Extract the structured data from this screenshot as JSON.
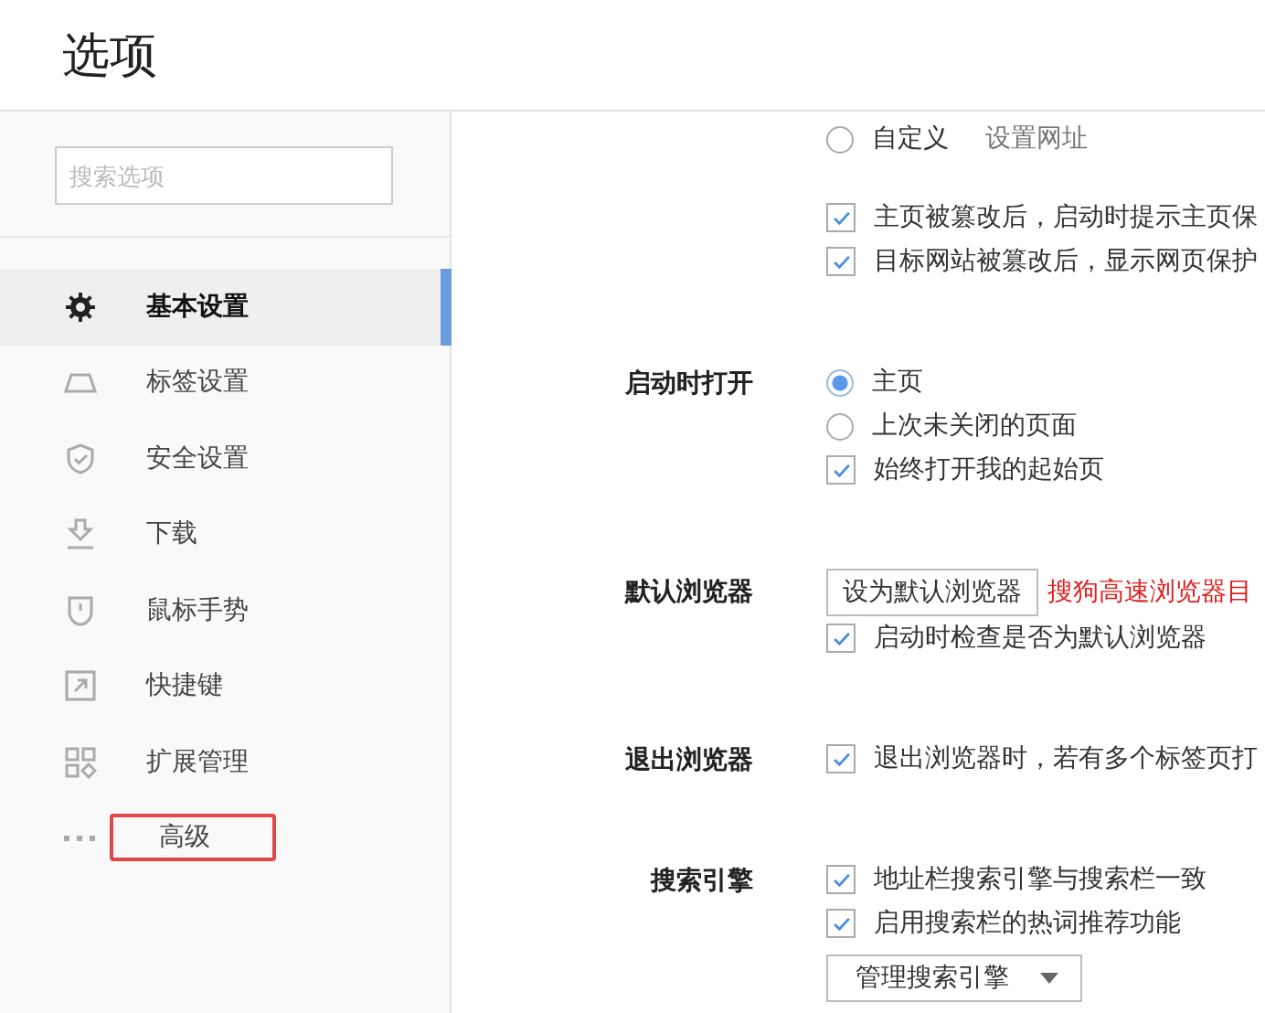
{
  "window": {
    "title": "选项"
  },
  "sidebar": {
    "search": {
      "placeholder": "搜索选项"
    },
    "items": [
      {
        "label": "基本设置",
        "selected": true,
        "highlighted": false
      },
      {
        "label": "标签设置",
        "selected": false,
        "highlighted": false
      },
      {
        "label": "安全设置",
        "selected": false,
        "highlighted": false
      },
      {
        "label": "下载",
        "selected": false,
        "highlighted": false
      },
      {
        "label": "鼠标手势",
        "selected": false,
        "highlighted": false
      },
      {
        "label": "快捷键",
        "selected": false,
        "highlighted": false
      },
      {
        "label": "扩展管理",
        "selected": false,
        "highlighted": false
      },
      {
        "label": "高级",
        "selected": false,
        "highlighted": true
      }
    ]
  },
  "sections": [
    {
      "items": [
        {
          "kind": "radio",
          "text": "自定义",
          "selected": false,
          "link": "设置网址"
        }
      ]
    },
    {
      "items": [
        {
          "kind": "checkbox",
          "text": "主页被篡改后，启动时提示主页保",
          "checked": true
        },
        {
          "kind": "checkbox",
          "text": "目标网站被篡改后，显示网页保护",
          "checked": true
        }
      ]
    },
    {
      "label": "启动时打开",
      "items": [
        {
          "kind": "radio",
          "text": "主页",
          "selected": true
        },
        {
          "kind": "radio",
          "text": "上次未关闭的页面",
          "selected": false
        },
        {
          "kind": "checkbox",
          "text": "始终打开我的起始页",
          "checked": true
        }
      ]
    },
    {
      "label": "默认浏览器",
      "items": [
        {
          "kind": "button",
          "text": "设为默认浏览器",
          "note": "搜狗高速浏览器目"
        },
        {
          "kind": "checkbox",
          "text": "启动时检查是否为默认浏览器",
          "checked": true
        }
      ]
    },
    {
      "label": "退出浏览器",
      "items": [
        {
          "kind": "checkbox",
          "text": "退出浏览器时，若有多个标签页打",
          "checked": true
        }
      ]
    },
    {
      "label": "搜索引擎",
      "items": [
        {
          "kind": "checkbox",
          "text": "地址栏搜索引擎与搜索栏一致",
          "checked": true
        },
        {
          "kind": "checkbox",
          "text": "启用搜索栏的热词推荐功能",
          "checked": true
        },
        {
          "kind": "dropdown",
          "text": "管理搜索引擎"
        }
      ]
    }
  ]
}
